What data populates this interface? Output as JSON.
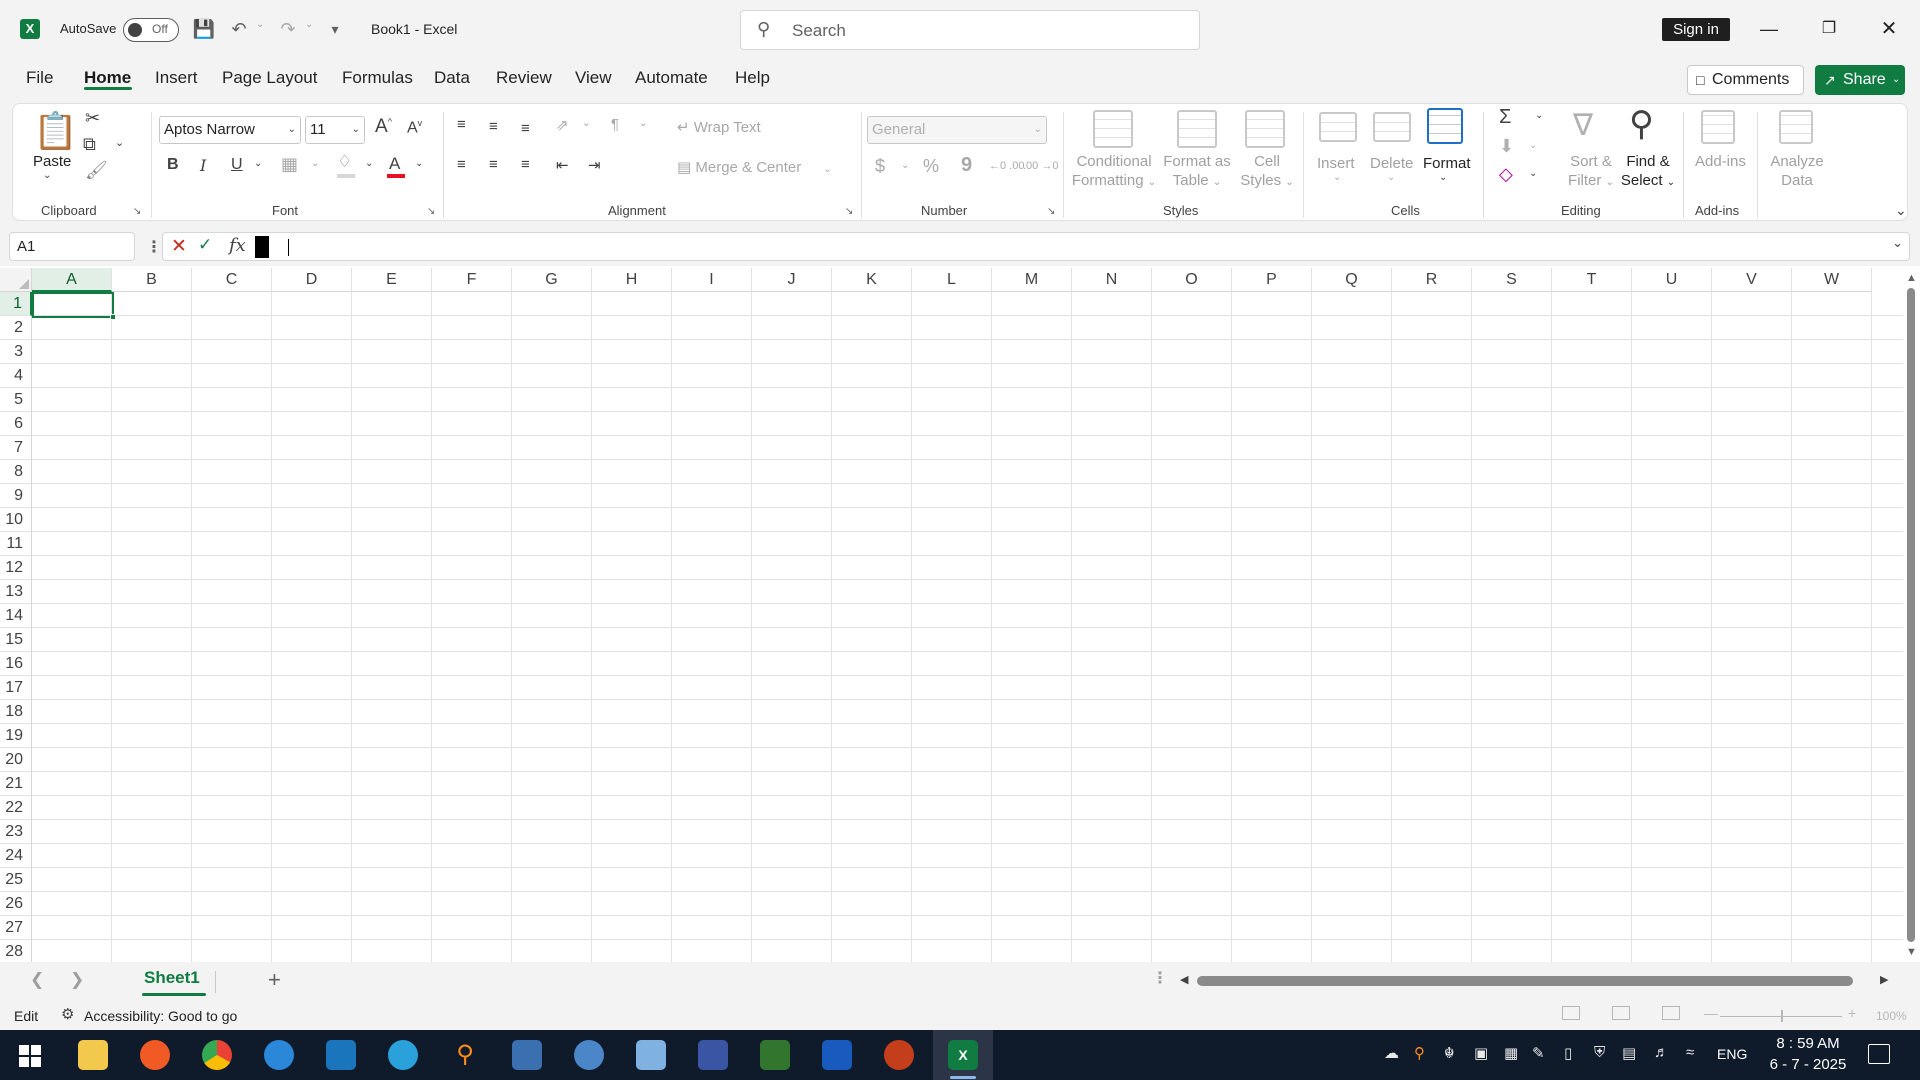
{
  "titlebar": {
    "app_icon": "X",
    "autosave_label": "AutoSave",
    "autosave_state": "Off",
    "doc_title": "Book1  -  Excel",
    "search_placeholder": "Search",
    "signin": "Sign in",
    "icons": [
      "save-icon",
      "undo-icon",
      "redo-icon",
      "customize-qat-icon",
      "minimize-icon",
      "restore-icon",
      "close-icon"
    ]
  },
  "tabs": [
    "File",
    "Home",
    "Insert",
    "Page Layout",
    "Formulas",
    "Data",
    "Review",
    "View",
    "Automate",
    "Help"
  ],
  "active_tab": "Home",
  "actions": {
    "comments": "Comments",
    "share": "Share"
  },
  "ribbon": {
    "clipboard": {
      "label": "Clipboard",
      "paste": "Paste"
    },
    "font": {
      "label": "Font",
      "family": "Aptos Narrow",
      "size": "11",
      "bold": "B",
      "italic": "I",
      "underline": "U",
      "grow": "A",
      "shrink": "A",
      "fontcolor": "A"
    },
    "alignment": {
      "label": "Alignment",
      "wrap": "Wrap Text",
      "merge": "Merge & Center"
    },
    "number": {
      "label": "Number",
      "format": "General",
      "currency": "$",
      "percent": "%",
      "comma": "9",
      "inc_decimal": "←0 .00",
      "dec_decimal": ".00 →0"
    },
    "styles": {
      "label": "Styles",
      "conditional": "Conditional Formatting",
      "conditional_l1": "Conditional",
      "conditional_l2": "Formatting",
      "format_table_l1": "Format as",
      "format_table_l2": "Table",
      "cell_styles_l1": "Cell",
      "cell_styles_l2": "Styles"
    },
    "cells": {
      "label": "Cells",
      "insert": "Insert",
      "delete": "Delete",
      "format": "Format"
    },
    "editing": {
      "label": "Editing",
      "sort_l1": "Sort &",
      "sort_l2": "Filter",
      "find_l1": "Find &",
      "find_l2": "Select"
    },
    "addins": {
      "label": "Add-ins",
      "addins": "Add-ins",
      "analyze_l1": "Analyze",
      "analyze_l2": "Data"
    }
  },
  "formula_bar": {
    "name_box": "A1",
    "fx": "fx",
    "value": ""
  },
  "grid": {
    "columns": [
      "A",
      "B",
      "C",
      "D",
      "E",
      "F",
      "G",
      "H",
      "I",
      "J",
      "K",
      "L",
      "M",
      "N",
      "O",
      "P",
      "Q",
      "R",
      "S",
      "T",
      "U",
      "V",
      "W"
    ],
    "rows": [
      "1",
      "2",
      "3",
      "4",
      "5",
      "6",
      "7",
      "8",
      "9",
      "10",
      "11",
      "12",
      "13",
      "14",
      "15",
      "16",
      "17",
      "18",
      "19",
      "20",
      "21",
      "22",
      "23",
      "24",
      "25",
      "26",
      "27",
      "28"
    ],
    "active_cell": "A1"
  },
  "sheets": {
    "tabs": [
      "Sheet1"
    ],
    "active": "Sheet1",
    "add": "+"
  },
  "status": {
    "mode": "Edit",
    "accessibility": "Accessibility: Good to go",
    "zoom": "100%"
  },
  "taskbar": {
    "apps": [
      "file-explorer",
      "brave",
      "chrome",
      "app",
      "app2",
      "telegram",
      "search-app",
      "app3",
      "qbittorrent",
      "calculator",
      "visio",
      "project",
      "word",
      "powerpoint",
      "excel"
    ],
    "lang": "ENG",
    "time": "8 : 59 AM",
    "date": "6 - 7 - 2025"
  }
}
